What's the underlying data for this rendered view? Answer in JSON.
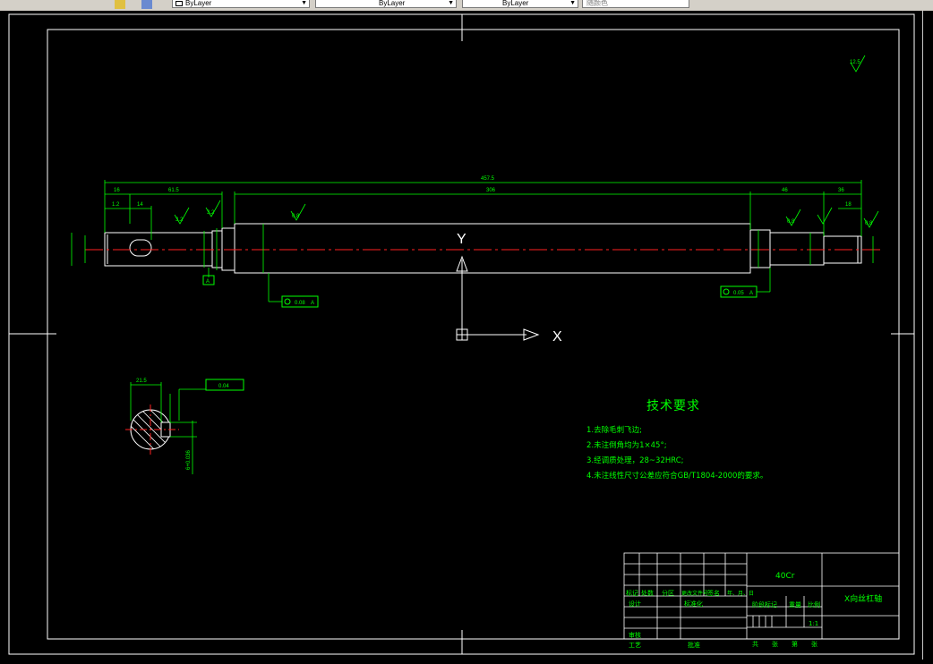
{
  "toolbar": {
    "layer_combo_1": "ByLayer",
    "layer_combo_2": "ByLayer",
    "layer_combo_3": "ByLayer",
    "plot_style": "随颜色"
  },
  "colors": {
    "background": "#000000",
    "green": "#00ff00",
    "white": "#ffffff",
    "centerline": "#ff2020"
  },
  "drawing": {
    "roughness_top_right": "12.5",
    "dim_overall": "457.5",
    "dim_main": "306",
    "dim_left_1": "16",
    "dim_left_2": "61.5",
    "dim_right_1": "46",
    "dim_right_2": "36",
    "dim_left_small_1": "1.2",
    "dim_left_small_2": "14",
    "dim_right_small": "18",
    "roughness_1": "3.2",
    "roughness_2": "0.8",
    "roughness_3": "0.8",
    "roughness_4": "0.8",
    "roughness_5": "3.2",
    "datum_a": "A",
    "tol_left": "0.08",
    "tol_left_ref": "A",
    "tol_right": "0.05",
    "tol_right_ref": "A",
    "section_dim": "21.5",
    "section_tol": "0.04",
    "section_dim_vert": "6+0.036",
    "ucs_x": "X",
    "ucs_y": "Y"
  },
  "tech_req": {
    "title": "技术要求",
    "items": [
      "1.去除毛刺飞边;",
      "2.未注倒角均为1×45°;",
      "3.经调质处理，28~32HRC;",
      "4.未注线性尺寸公差应符合GB/T1804-2000的要求。"
    ]
  },
  "title_block": {
    "material": "40Cr",
    "part_name": "X向丝杠轴",
    "scale": "1:1",
    "headers_row": [
      "标记",
      "处数",
      "分区",
      "更改文件号",
      "签名",
      "年、月、日"
    ],
    "design": "设计",
    "standardize": "标准化",
    "stage_mark": "阶段标记",
    "weight": "重量",
    "scale_label": "比例",
    "review": "审核",
    "process": "工艺",
    "approve": "批准",
    "sheet": [
      "共",
      "张",
      "第",
      "张"
    ]
  }
}
